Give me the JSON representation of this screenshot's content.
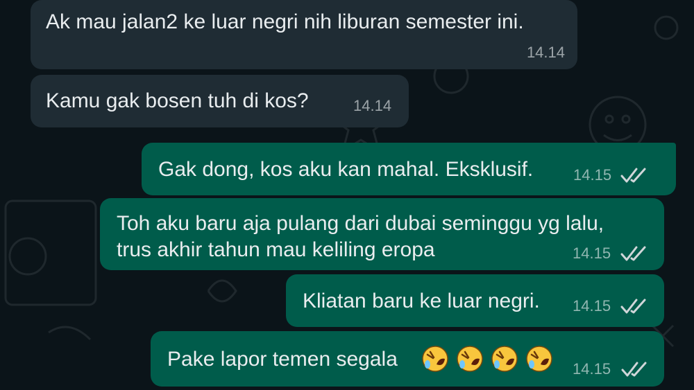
{
  "chat": {
    "messages": [
      {
        "direction": "incoming",
        "text": "Ak mau jalan2 ke luar negri nih liburan semester ini.",
        "time": "14.14"
      },
      {
        "direction": "incoming",
        "text": "Kamu gak bosen tuh di kos?",
        "time": "14.14"
      },
      {
        "direction": "outgoing",
        "text": "Gak dong, kos aku kan mahal. Eksklusif.",
        "time": "14.15",
        "status": "read"
      },
      {
        "direction": "outgoing",
        "text": "Toh aku baru aja pulang dari dubai seminggu yg lalu,\ntrus akhir tahun mau keliling eropa",
        "time": "14.15",
        "status": "read"
      },
      {
        "direction": "outgoing",
        "text": "Kliatan baru ke luar negri.",
        "time": "14.15",
        "status": "read"
      },
      {
        "direction": "outgoing",
        "text": "Pake lapor temen segala",
        "emoji": [
          "rolling-on-the-floor-laughing",
          "rolling-on-the-floor-laughing",
          "rolling-on-the-floor-laughing",
          "rolling-on-the-floor-laughing"
        ],
        "time": "14.15",
        "status": "read"
      }
    ]
  },
  "theme": {
    "background": "#0b1419",
    "incoming_bubble": "#1f2c34",
    "outgoing_bubble": "#005c4b",
    "text": "#e9edef",
    "read_ticks": "#d0d6d9"
  }
}
